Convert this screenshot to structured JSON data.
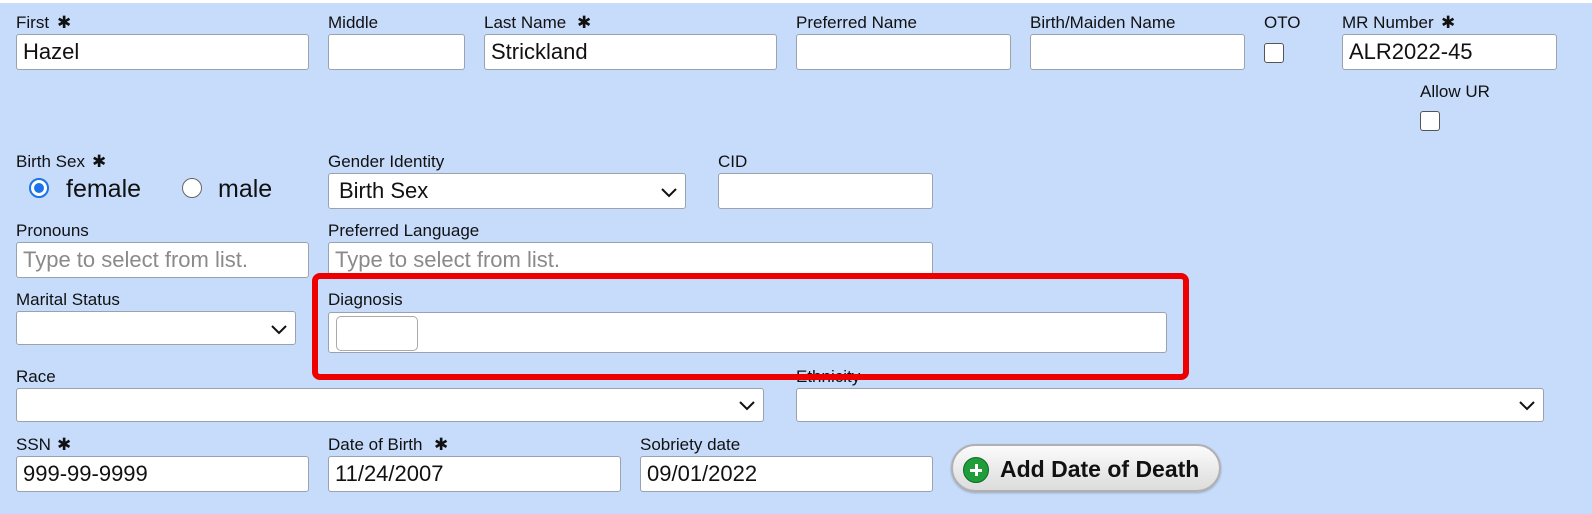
{
  "row1": {
    "first": {
      "label": "First",
      "value": "Hazel"
    },
    "middle": {
      "label": "Middle",
      "value": ""
    },
    "last": {
      "label": "Last Name",
      "value": "Strickland"
    },
    "preferred": {
      "label": "Preferred Name",
      "value": ""
    },
    "birth_maiden": {
      "label": "Birth/Maiden Name",
      "value": ""
    },
    "oto": {
      "label": "OTO",
      "checked": false
    },
    "mr_number": {
      "label": "MR Number",
      "value": "ALR2022-45"
    },
    "allow_ur": {
      "label": "Allow UR",
      "checked": false
    }
  },
  "required_mark": "✱",
  "birth_sex": {
    "label": "Birth Sex",
    "options": [
      {
        "label": "female",
        "selected": true
      },
      {
        "label": "male",
        "selected": false
      }
    ]
  },
  "gender_identity": {
    "label": "Gender Identity",
    "value": "Birth Sex"
  },
  "cid": {
    "label": "CID",
    "value": ""
  },
  "pronouns": {
    "label": "Pronouns",
    "placeholder": "Type to select from list."
  },
  "preferred_language": {
    "label": "Preferred Language",
    "placeholder": "Type to select from list."
  },
  "marital_status": {
    "label": "Marital Status",
    "value": ""
  },
  "diagnosis": {
    "label": "Diagnosis",
    "value": ""
  },
  "race": {
    "label": "Race",
    "value": ""
  },
  "ethnicity": {
    "label": "Ethnicity",
    "value": ""
  },
  "ssn": {
    "label": "SSN",
    "value": "999-99-9999"
  },
  "dob": {
    "label": "Date of Birth",
    "value": "11/24/2007"
  },
  "sobriety": {
    "label": "Sobriety date",
    "value": "09/01/2022"
  },
  "death_button": {
    "label": "Add Date of Death",
    "icon": "plus-circle-icon"
  },
  "colors": {
    "panel_bg": "#c7dcfb",
    "highlight": "#ee0000",
    "radio_accent": "#1a73e8",
    "add_icon": "#1f9d3a"
  }
}
